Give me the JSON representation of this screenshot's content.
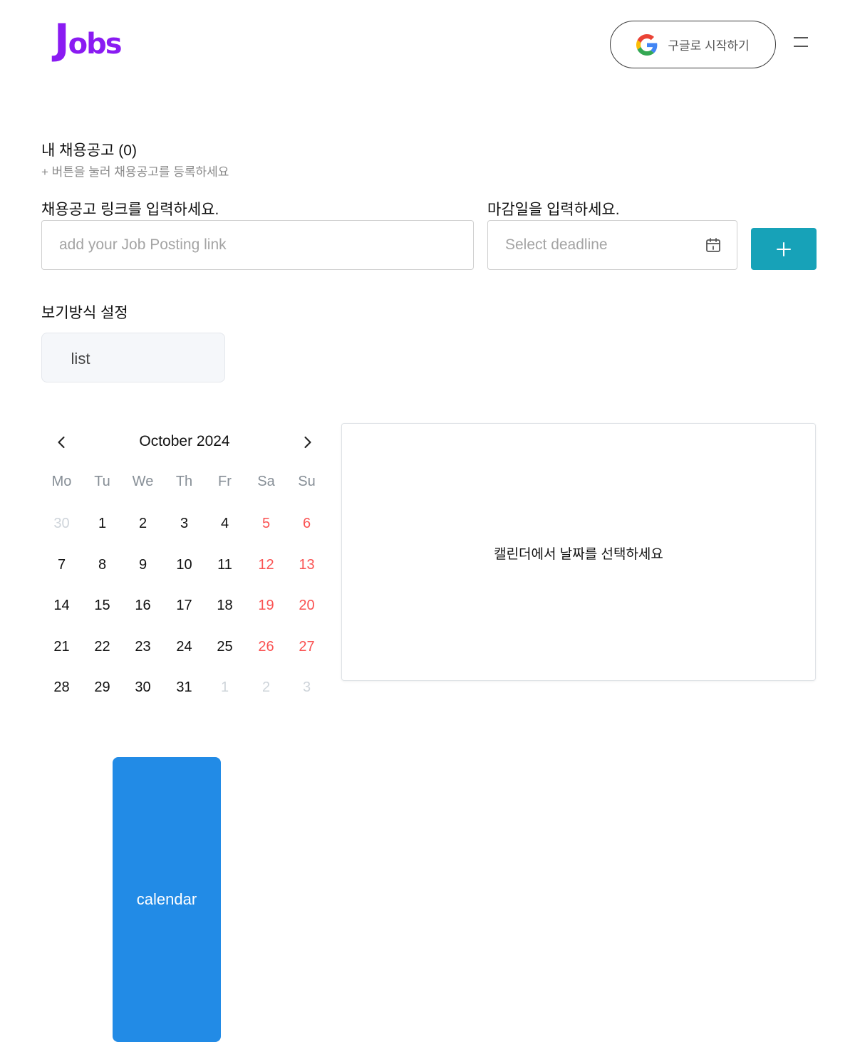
{
  "header": {
    "logo_big": "J",
    "logo_small": "obs",
    "google_button_label": "구글로 시작하기"
  },
  "jobs_section": {
    "title": "내 채용공고 (0)",
    "subtitle": "+ 버튼을 눌러 채용공고를 등록하세요"
  },
  "form": {
    "link_label": "채용공고 링크를 입력하세요.",
    "link_placeholder": "add your Job Posting link",
    "link_value": "",
    "deadline_label": "마감일을 입력하세요.",
    "deadline_placeholder": "Select deadline"
  },
  "view_mode": {
    "title": "보기방식 설정",
    "options": [
      "list",
      "calendar"
    ],
    "selected": "calendar"
  },
  "calendar": {
    "month_label": "October 2024",
    "weekdays": [
      "Mo",
      "Tu",
      "We",
      "Th",
      "Fr",
      "Sa",
      "Su"
    ],
    "weeks": [
      [
        {
          "d": "30",
          "outside": true
        },
        {
          "d": "1"
        },
        {
          "d": "2"
        },
        {
          "d": "3"
        },
        {
          "d": "4"
        },
        {
          "d": "5",
          "weekend": true
        },
        {
          "d": "6",
          "weekend": true
        }
      ],
      [
        {
          "d": "7"
        },
        {
          "d": "8"
        },
        {
          "d": "9"
        },
        {
          "d": "10"
        },
        {
          "d": "11"
        },
        {
          "d": "12",
          "weekend": true
        },
        {
          "d": "13",
          "weekend": true
        }
      ],
      [
        {
          "d": "14"
        },
        {
          "d": "15"
        },
        {
          "d": "16"
        },
        {
          "d": "17"
        },
        {
          "d": "18"
        },
        {
          "d": "19",
          "weekend": true
        },
        {
          "d": "20",
          "weekend": true
        }
      ],
      [
        {
          "d": "21"
        },
        {
          "d": "22"
        },
        {
          "d": "23"
        },
        {
          "d": "24"
        },
        {
          "d": "25"
        },
        {
          "d": "26",
          "weekend": true
        },
        {
          "d": "27",
          "weekend": true
        }
      ],
      [
        {
          "d": "28"
        },
        {
          "d": "29"
        },
        {
          "d": "30"
        },
        {
          "d": "31"
        },
        {
          "d": "1",
          "outside": true
        },
        {
          "d": "2",
          "outside": true
        },
        {
          "d": "3",
          "outside": true
        }
      ]
    ]
  },
  "detail": {
    "empty_message": "캘린더에서 날짜를 선택하세요"
  },
  "colors": {
    "logo": "#8a1bf2",
    "add_button": "#17a2b8",
    "toggle_active": "#228be6",
    "weekend": "#fa5252",
    "outside_day": "#ced4da"
  },
  "icons": [
    "google-icon",
    "menu-icon",
    "calendar-icon",
    "plus-icon",
    "chevron-left-icon",
    "chevron-right-icon"
  ]
}
